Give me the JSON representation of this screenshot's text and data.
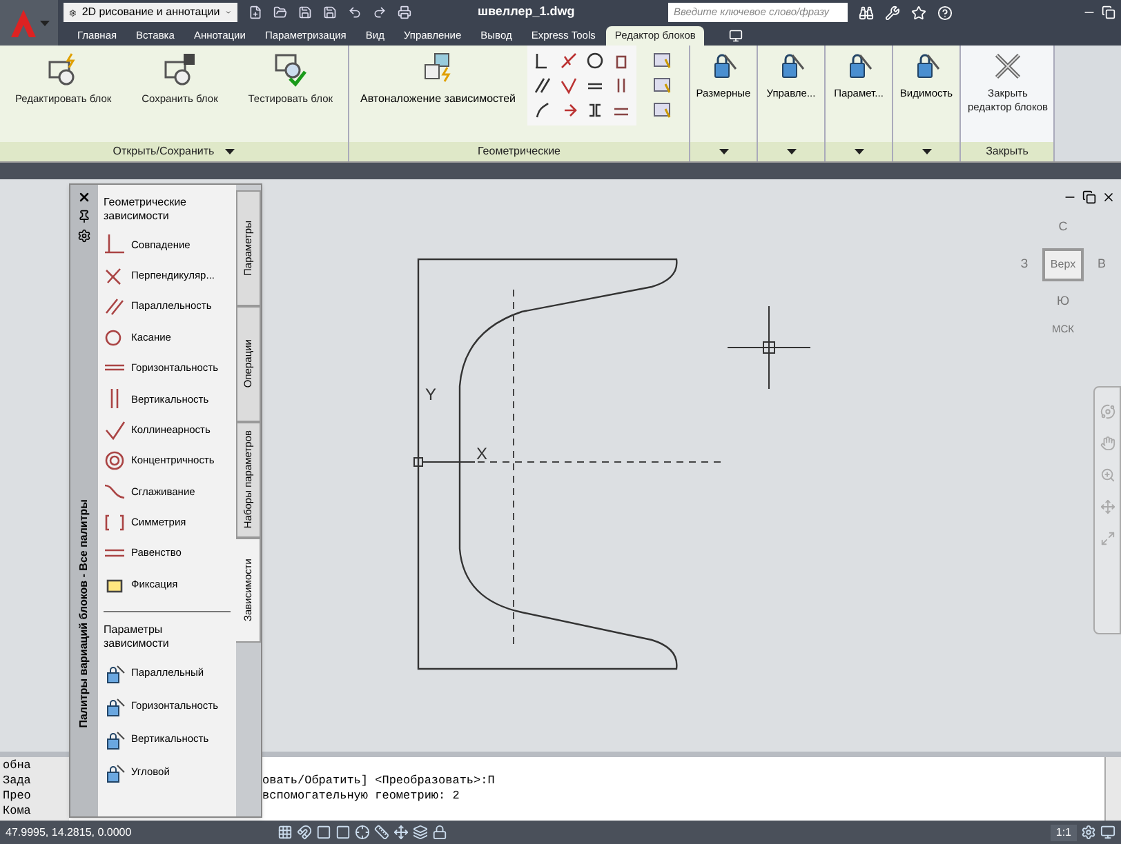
{
  "workspace": {
    "label": "2D рисование и аннотации"
  },
  "title": "швеллер_1.dwg",
  "search": {
    "placeholder": "Введите ключевое слово/фразу"
  },
  "ribbon_tabs": [
    {
      "label": "Главная",
      "selected": false
    },
    {
      "label": "Вставка",
      "selected": false
    },
    {
      "label": "Аннотации",
      "selected": false
    },
    {
      "label": "Параметризация",
      "selected": false
    },
    {
      "label": "Вид",
      "selected": false
    },
    {
      "label": "Управление",
      "selected": false
    },
    {
      "label": "Вывод",
      "selected": false
    },
    {
      "label": "Express Tools",
      "selected": false
    },
    {
      "label": "Редактор блоков",
      "selected": true
    }
  ],
  "ribbon_panels": [
    {
      "kind": "buttons",
      "title": "Открыть/Сохранить",
      "menu": true,
      "buttons": [
        {
          "label": "Редактировать блок"
        },
        {
          "label": "Сохранить блок"
        },
        {
          "label": "Тестировать блок"
        }
      ]
    },
    {
      "kind": "geometric",
      "title": "Геометрические",
      "buttons": [
        {
          "label": "Автоналожение зависимостей"
        }
      ]
    },
    {
      "kind": "dropdown",
      "label": "Размерные"
    },
    {
      "kind": "dropdown",
      "label": "Управле..."
    },
    {
      "kind": "dropdown",
      "label": "Парамет..."
    },
    {
      "kind": "dropdown",
      "label": "Видимость"
    },
    {
      "kind": "buttons",
      "title": "Закрыть",
      "menu": false,
      "buttons": [
        {
          "label": "Закрыть редактор блоков"
        }
      ]
    }
  ],
  "palette": {
    "title": "Палитры вариаций блоков - Все палитры",
    "sections": [
      {
        "title": "Геометрические зависимости",
        "items": [
          "Совпадение",
          "Перпендикуляр...",
          "Параллельность",
          "Касание",
          "Горизонтальность",
          "Вертикальность",
          "Коллинеарность",
          "Концентричность",
          "Сглаживание",
          "Симметрия",
          "Равенство",
          "Фиксация"
        ]
      },
      {
        "title": "Параметры зависимости",
        "items": [
          "Параллельный",
          "Горизонтальность",
          "Вертикальность",
          "Угловой"
        ]
      }
    ],
    "tabs": [
      {
        "label": "Параметры",
        "selected": false
      },
      {
        "label": "Операции",
        "selected": false
      },
      {
        "label": "Наборы параметров",
        "selected": false
      },
      {
        "label": "Зависимости",
        "selected": true
      }
    ]
  },
  "drawing": {
    "ucs_y": "Y",
    "ucs_x": "X"
  },
  "viewcube": {
    "north": "С",
    "west": "З",
    "top": "Верх",
    "east": "В",
    "south": "Ю",
    "ucs": "МСК"
  },
  "command": {
    "lines": [
      {
        "prefix": "обна"
      },
      {
        "prefix": "Зада",
        "text": "овать/Обратить] <Преобразовать>:П"
      },
      {
        "prefix": "Прео",
        "text": "вспомогательную геометрию: 2"
      },
      {
        "prefix": "Кома"
      }
    ]
  },
  "status_bar": {
    "coordinates": "47.9995, 14.2815, 0.0000",
    "annotation_scale": "1:1"
  }
}
